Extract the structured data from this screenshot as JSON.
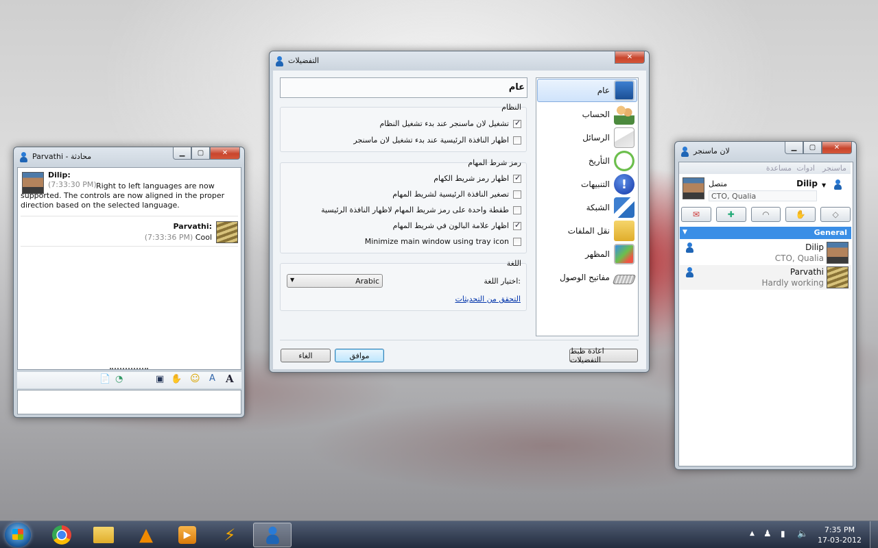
{
  "chat": {
    "title": "Parvathi - محادثة",
    "messages": [
      {
        "sender": "Dilip:",
        "time": "(7:33:30 PM)",
        "text": "Right to left languages are now supported. The controls are now aligned in the proper direction based on the selected language."
      },
      {
        "sender": "Parvathi:",
        "time": "(7:33:36 PM)",
        "text": "Cool"
      }
    ]
  },
  "prefs": {
    "title": "التفضيلات",
    "section_title": "عام",
    "nav": [
      "عام",
      "الحساب",
      "الرسائل",
      "التأريخ",
      "التنبيهات",
      "الشبكة",
      "نقل الملفات",
      "المظهر",
      "مفاتيح الوصول"
    ],
    "groups": [
      {
        "title": "النظام",
        "options": [
          {
            "label": "تشغيل لان ماسنجر عند بدء تشغيل النظام",
            "checked": true
          },
          {
            "label": "اظهار النافذة الرئيسية عند بدء تشغيل لان ماسنجر",
            "checked": false
          }
        ]
      },
      {
        "title": "رمز شرط المهام",
        "options": [
          {
            "label": "اظهار رمز شريط الكهام",
            "checked": true
          },
          {
            "label": "تصغير النافذة الرئيسية لشريط المهام",
            "checked": false
          },
          {
            "label": "طقطة واحدة على رمز شريط المهام لاظهار النافذة الرئيسية",
            "checked": false
          },
          {
            "label": "اظهار علامة البالون في شريط المهام",
            "checked": true
          },
          {
            "label": "Minimize main window using tray icon",
            "checked": false
          }
        ]
      },
      {
        "title": "اللغة"
      }
    ],
    "language_label": "اختيار اللغة:",
    "language_value": "Arabic",
    "update_link": "التحقق من التحديثات",
    "reset_button": "اعادة ظبط التفضيلات",
    "ok_button": "موافق",
    "cancel_button": "الغاء"
  },
  "main": {
    "title": "لان ماسنجر",
    "menu": [
      "ماسنجر",
      "ادوات",
      "مساعدة"
    ],
    "user_name": "Dilip",
    "status": "متصل",
    "user_note": "CTO, Qualia",
    "group_name": "General",
    "contacts": [
      {
        "name": "Dilip",
        "note": "CTO, Qualia"
      },
      {
        "name": "Parvathi",
        "note": "Hardly working"
      }
    ]
  },
  "taskbar": {
    "time": "7:35 PM",
    "date": "17-03-2012"
  },
  "colors": {
    "accent": "#3a8ee6",
    "link": "#0033aa"
  }
}
